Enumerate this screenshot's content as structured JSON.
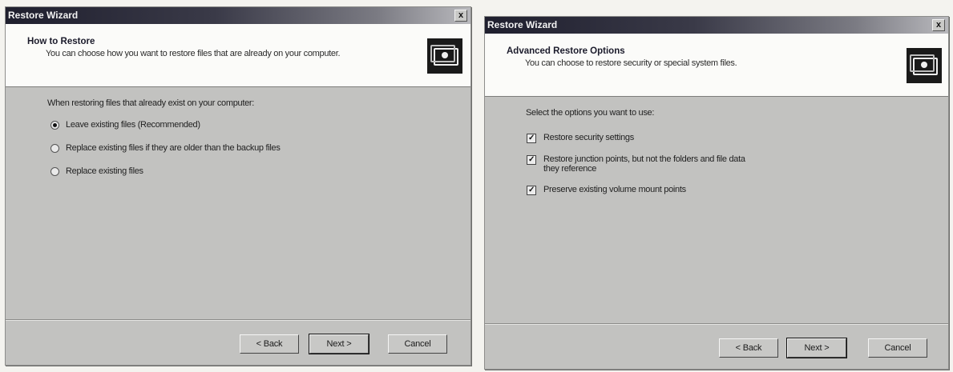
{
  "left_window": {
    "title": "Restore Wizard",
    "close_label": "x",
    "header_title": "How to Restore",
    "header_subtitle": "You can choose how you want to restore files that are already on your computer.",
    "prompt": "When restoring files that already exist on your computer:",
    "options": [
      {
        "label": "Leave existing files (Recommended)",
        "checked": true
      },
      {
        "label": "Replace existing files if they are older than the backup files",
        "checked": false
      },
      {
        "label": "Replace existing files",
        "checked": false
      }
    ],
    "buttons": {
      "back": "< Back",
      "next": "Next >",
      "cancel": "Cancel"
    }
  },
  "right_window": {
    "title": "Restore Wizard",
    "close_label": "x",
    "header_title": "Advanced Restore Options",
    "header_subtitle": "You can choose to restore security or special system files.",
    "prompt": "Select the options you want to use:",
    "options": [
      {
        "label": "Restore security settings",
        "label_line2": "",
        "checked": true
      },
      {
        "label": "Restore junction points, but not the folders and file data",
        "label_line2": "they reference",
        "checked": true
      },
      {
        "label": "Preserve existing volume mount points",
        "label_line2": "",
        "checked": true
      }
    ],
    "buttons": {
      "back": "< Back",
      "next": "Next >",
      "cancel": "Cancel"
    }
  },
  "icons": {
    "wizard_icon": "restore-wizard-icon",
    "checkmark": "✓"
  },
  "colors": {
    "dialog_background": "#c2c2c0",
    "header_background": "#fbfbf9",
    "titlebar_dark": "#1f1f2e"
  }
}
